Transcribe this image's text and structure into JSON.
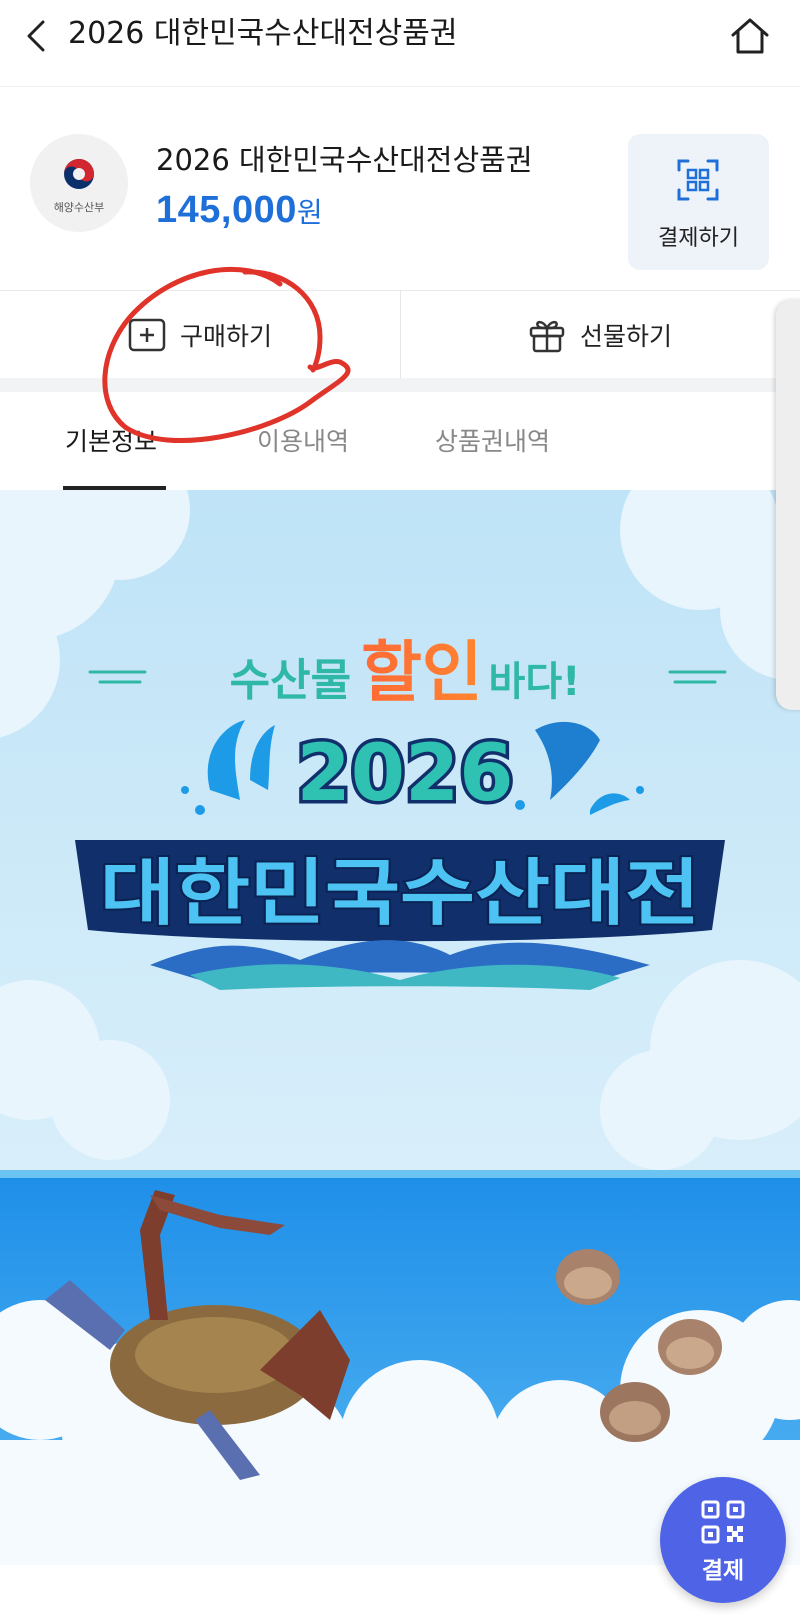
{
  "header": {
    "title": "2026 대한민국수산대전상품권",
    "back_icon": "chevron-left-icon",
    "home_icon": "home-icon"
  },
  "product": {
    "issuer_logo_text": "해양수산부",
    "name": "2026 대한민국수산대전상품권",
    "price": "145,000",
    "price_unit": "원",
    "pay_label": "결제하기",
    "price_color": "#1f6fd9"
  },
  "actions": {
    "buy_label": "구매하기",
    "gift_label": "선물하기"
  },
  "tabs": [
    {
      "label": "기본정보",
      "active": true
    },
    {
      "label": "이용내역",
      "active": false
    },
    {
      "label": "상품권내역",
      "active": false
    }
  ],
  "banner": {
    "tagline_part1": "수산물",
    "tagline_highlight": "할인",
    "tagline_part2": "바다!",
    "year": "2026",
    "event_name": "대한민국수산대전"
  },
  "fab": {
    "label": "결제"
  },
  "colors": {
    "accent": "#4f63e6",
    "annotation": "#e0342a"
  }
}
